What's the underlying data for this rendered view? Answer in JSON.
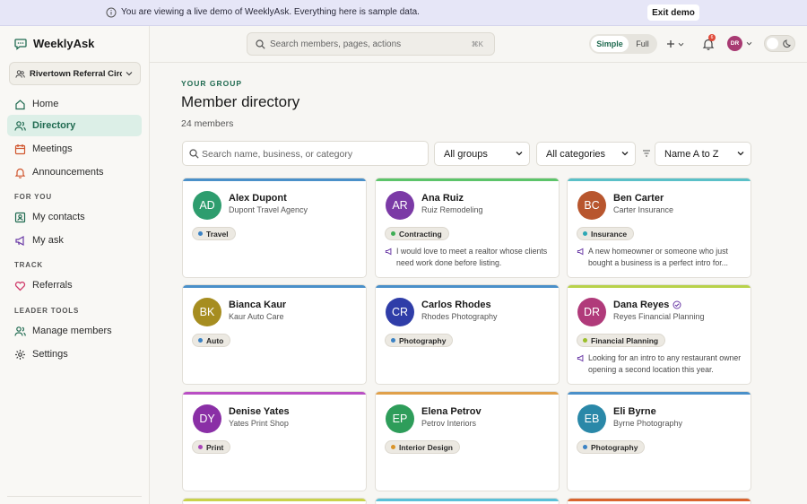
{
  "banner": {
    "message": "You are viewing a live demo of WeeklyAsk. Everything here is sample data.",
    "exit_label": "Exit demo"
  },
  "app": {
    "name": "WeeklyAsk"
  },
  "sidebar": {
    "group_name": "Rivertown Referral Circle",
    "nav_main": [
      {
        "label": "Home",
        "icon": "home-icon"
      },
      {
        "label": "Directory",
        "icon": "people-icon",
        "active": true
      },
      {
        "label": "Meetings",
        "icon": "calendar-icon"
      },
      {
        "label": "Announcements",
        "icon": "bell-icon"
      }
    ],
    "section_for_you": "FOR YOU",
    "nav_for_you": [
      {
        "label": "My contacts",
        "icon": "contact-card-icon"
      },
      {
        "label": "My ask",
        "icon": "megaphone-icon"
      }
    ],
    "section_track": "TRACK",
    "nav_track": [
      {
        "label": "Referrals",
        "icon": "heart-icon"
      }
    ],
    "section_leader": "LEADER TOOLS",
    "nav_leader": [
      {
        "label": "Manage members",
        "icon": "people-gear-icon"
      },
      {
        "label": "Settings",
        "icon": "gear-icon"
      }
    ]
  },
  "topbar": {
    "search_placeholder": "Search members, pages, actions",
    "search_shortcut": "⌘K",
    "mode_simple": "Simple",
    "mode_full": "Full",
    "notification_count": "6",
    "user_initials": "DR"
  },
  "main": {
    "eyebrow": "YOUR GROUP",
    "title": "Member directory",
    "member_count": "24 members",
    "filter_search_placeholder": "Search name, business, or category",
    "group_filter": "All groups",
    "category_filter": "All categories",
    "sort": "Name A to Z"
  },
  "colors": {
    "accent": "#1f6a50",
    "active_nav_bg": "#dcefe7"
  },
  "members": [
    {
      "initials": "AD",
      "name": "Alex Dupont",
      "business": "Dupont Travel Agency",
      "category": "Travel",
      "ask": "",
      "avatar_color": "#2e9d6e",
      "stripe_color": "#4a90c9",
      "dot_color": "#3b82c4",
      "verified": false
    },
    {
      "initials": "AR",
      "name": "Ana Ruiz",
      "business": "Ruiz Remodeling",
      "category": "Contracting",
      "ask": "I would love to meet a realtor whose clients need work done before listing.",
      "avatar_color": "#7b3aa6",
      "stripe_color": "#5cc46a",
      "dot_color": "#3fae55",
      "verified": false
    },
    {
      "initials": "BC",
      "name": "Ben Carter",
      "business": "Carter Insurance",
      "category": "Insurance",
      "ask": "A new homeowner or someone who just bought a business is a perfect intro for...",
      "avatar_color": "#b8562e",
      "stripe_color": "#5ac0c8",
      "dot_color": "#2ea8b5",
      "verified": false
    },
    {
      "initials": "BK",
      "name": "Bianca Kaur",
      "business": "Kaur Auto Care",
      "category": "Auto",
      "ask": "",
      "avatar_color": "#a68d20",
      "stripe_color": "#4a90c9",
      "dot_color": "#3b82c4",
      "verified": false
    },
    {
      "initials": "CR",
      "name": "Carlos Rhodes",
      "business": "Rhodes Photography",
      "category": "Photography",
      "ask": "",
      "avatar_color": "#2f3da8",
      "stripe_color": "#4a90c9",
      "dot_color": "#3b82c4",
      "verified": false
    },
    {
      "initials": "DR",
      "name": "Dana Reyes",
      "business": "Reyes Financial Planning",
      "category": "Financial Planning",
      "ask": "Looking for an intro to any restaurant owner opening a second location this year.",
      "avatar_color": "#b03a7a",
      "stripe_color": "#b8d24a",
      "dot_color": "#9bbf2a",
      "verified": true
    },
    {
      "initials": "DY",
      "name": "Denise Yates",
      "business": "Yates Print Shop",
      "category": "Print",
      "ask": "",
      "avatar_color": "#8a2fa6",
      "stripe_color": "#b94fc4",
      "dot_color": "#a845b8",
      "verified": false
    },
    {
      "initials": "EP",
      "name": "Elena Petrov",
      "business": "Petrov Interiors",
      "category": "Interior Design",
      "ask": "",
      "avatar_color": "#2e9d5a",
      "stripe_color": "#e0a04a",
      "dot_color": "#d9942a",
      "verified": false
    },
    {
      "initials": "EB",
      "name": "Eli Byrne",
      "business": "Byrne Photography",
      "category": "Photography",
      "ask": "",
      "avatar_color": "#2a88a8",
      "stripe_color": "#4a90c9",
      "dot_color": "#3b82c4",
      "verified": false
    }
  ],
  "partial_row_stripes": [
    "#c9d24a",
    "#5ac0d8",
    "#d9642e"
  ]
}
